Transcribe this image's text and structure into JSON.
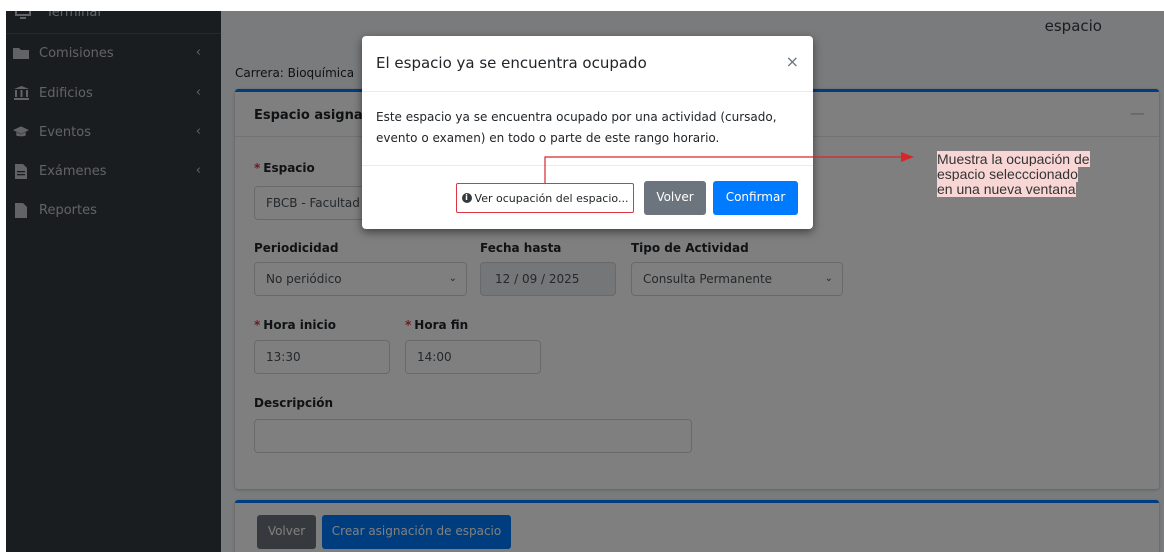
{
  "sidebar": {
    "top_label": "Terminal",
    "items": [
      {
        "label": "Comisiones",
        "icon": "folder-icon",
        "has_chevron": true
      },
      {
        "label": "Edificios",
        "icon": "bank-icon",
        "has_chevron": true
      },
      {
        "label": "Eventos",
        "icon": "graduation-cap-icon",
        "has_chevron": true
      },
      {
        "label": "Exámenes",
        "icon": "file-icon",
        "has_chevron": true
      },
      {
        "label": "Reportes",
        "icon": "file-icon",
        "has_chevron": false
      }
    ]
  },
  "header": {
    "title": "espacio"
  },
  "carrera": "Carrera: Bioquímica",
  "form": {
    "card_title": "Espacio asignado",
    "espacio_label": "Espacio",
    "espacio_value": "FBCB - Facultad",
    "periodicidad_label": "Periodicidad",
    "periodicidad_value": "No periódico",
    "fecha_hasta_label": "Fecha hasta",
    "fecha_hasta_value": "12 / 09 / 2025",
    "tipo_label": "Tipo de Actividad",
    "tipo_value": "Consulta Permanente",
    "hora_inicio_label": "Hora inicio",
    "hora_inicio_value": "13:30",
    "hora_fin_label": "Hora fin",
    "hora_fin_value": "14:00",
    "descripcion_label": "Descripción",
    "descripcion_value": ""
  },
  "bottom": {
    "volver_label": "Volver",
    "crear_label": "Crear asignación de espacio"
  },
  "modal": {
    "title": "El espacio ya se encuentra ocupado",
    "close_glyph": "×",
    "body_line1": "Este espacio ya se encuentra ocupado por una actividad (cursado,",
    "body_line2": "evento o examen) en todo o parte de este rango horario.",
    "ver_label": "Ver ocupación del espacio...",
    "volver_label": "Volver",
    "confirmar_label": "Confirmar"
  },
  "annotation": {
    "line1": "Muestra la ocupación de",
    "line2": "espacio selecccionado",
    "line3": "en una nueva ventana"
  },
  "colors": {
    "primary": "#007bff",
    "secondary": "#6c757d",
    "sidebar": "#343a40",
    "danger": "#dc3545",
    "annotation_arrow": "#d62728",
    "annotation_bg": "#f9d6d6"
  }
}
